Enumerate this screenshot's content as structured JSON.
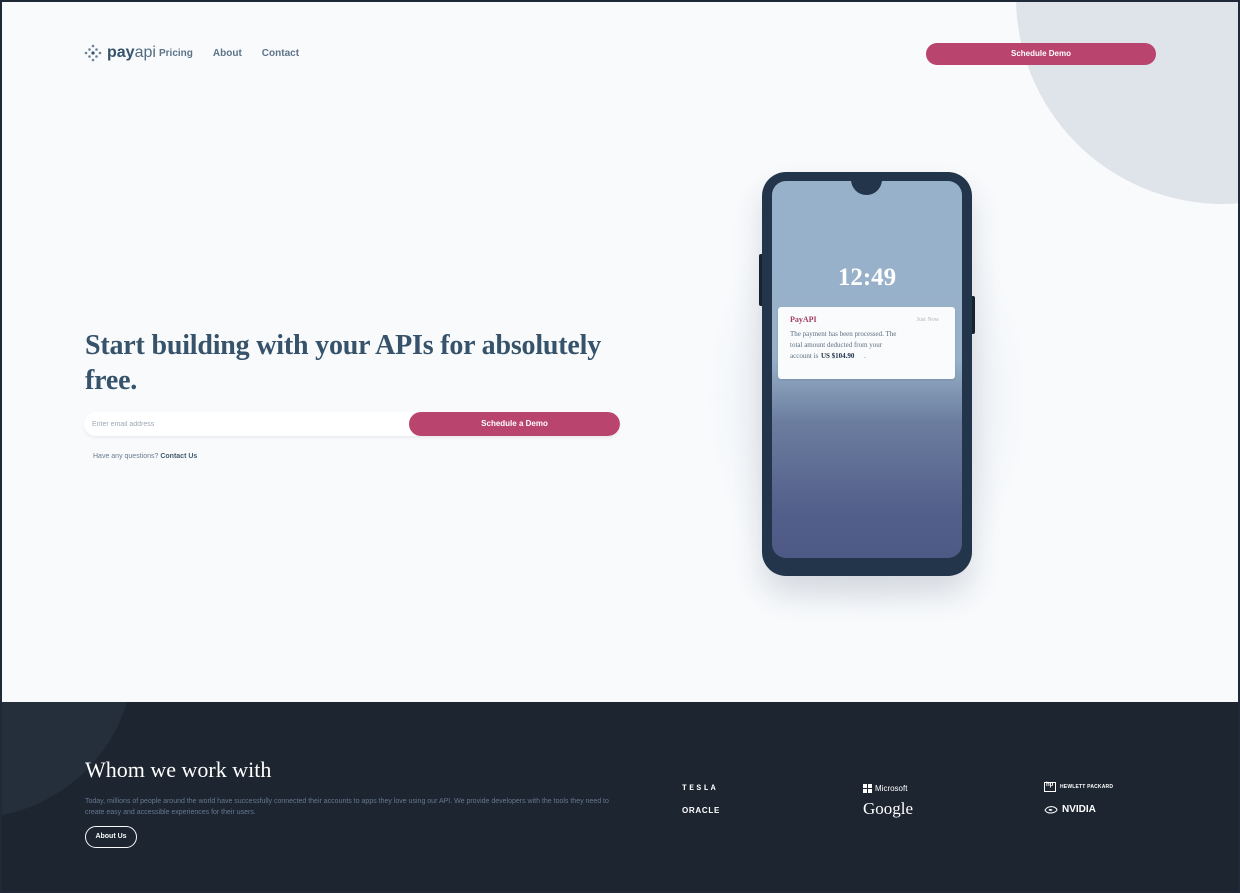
{
  "colors": {
    "background": "#f8fafc",
    "accent": "#b9446e",
    "dark": "#1c2530",
    "heading": "#36536b"
  },
  "nav": {
    "logo": {
      "primary": "pay",
      "secondary": "api",
      "icon": "dotted-diamond-icon"
    },
    "links": [
      "Pricing",
      "About",
      "Contact"
    ],
    "cta": "Schedule Demo"
  },
  "hero": {
    "headline": "Start building with your APIs for absolutely free.",
    "email_placeholder": "Enter email address",
    "email_value": "",
    "submit_label": "Schedule a Demo",
    "help_prefix": "Have any questions?",
    "help_link": "Contact Us"
  },
  "phone": {
    "time": "12:49",
    "notification": {
      "brand": "PayAPI",
      "status": "Just Now",
      "line1": "The payment has been processed. The",
      "line2": "total amount deducted from your",
      "line3_prefix": "account is",
      "amount": "US $104.90",
      "line3_suffix": "."
    }
  },
  "partners": {
    "title": "Whom we work with",
    "body": "Today, millions of people around the world have successfully connected their accounts to apps they love using our API. We provide developers with the tools they need to create easy and accessible experiences for their users.",
    "button": "About Us",
    "brands": {
      "tesla": "TESLA",
      "oracle": "ORACLE",
      "microsoft": "Microsoft",
      "google": "Google",
      "hp": "HEWLETT PACKARD",
      "nvidia": "NVIDIA"
    }
  }
}
